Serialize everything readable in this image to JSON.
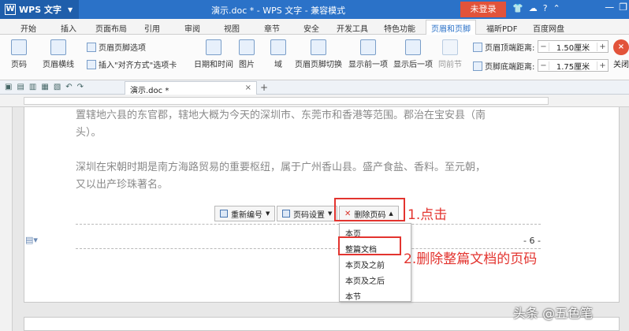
{
  "titlebar": {
    "app_name": "WPS 文字",
    "title": "演示.doc * - WPS 文字 - 兼容模式",
    "login": "未登录"
  },
  "menu_tabs": [
    "开始",
    "插入",
    "页面布局",
    "引用",
    "审阅",
    "视图",
    "章节",
    "安全",
    "开发工具",
    "特色功能",
    "页眉和页脚",
    "福昕PDF",
    "百度网盘"
  ],
  "active_tab": "页眉和页脚",
  "ribbon": {
    "page_number": "页码",
    "header_line": "页眉横线",
    "header_footer_options": "页眉页脚选项",
    "insert_align_tab": "插入\"对齐方式\"选项卡",
    "date_time": "日期和时间",
    "picture": "图片",
    "field": "域",
    "hf_switch": "页眉页脚切换",
    "show_prev": "显示前一项",
    "show_next": "显示后一项",
    "same_section": "同前节",
    "header_top_dist_label": "页眉顶端距离:",
    "header_top_dist_value": "1.50厘米",
    "footer_bottom_dist_label": "页脚底端距离:",
    "footer_bottom_dist_value": "1.75厘米",
    "close": "关闭"
  },
  "doc_tab": {
    "name": "演示.doc *"
  },
  "document": {
    "para1_line1": "置辖地六县的东官郡，辖地大概为今天的深圳市、东莞市和香港等范围。郡治在宝安县（南",
    "para1_line2": "头）。",
    "para2_line1": "深圳在宋朝时期是南方海路贸易的重要枢纽，属于广州香山县。盛产食盐、香料。至元朝，",
    "para2_line2": "又以出产珍珠著名。"
  },
  "page_number_toolbar": {
    "renumber": "重新编号",
    "settings": "页码设置",
    "delete": "删除页码"
  },
  "delete_menu": {
    "items": [
      "本页",
      "整篇文档",
      "本页及之前",
      "本页及之后",
      "本节"
    ]
  },
  "page_number_text": "- 6 -",
  "annotations": {
    "step1": "1.点击",
    "step2": "2.删除整篇文档的页码"
  },
  "watermark": "头条 @五色笔",
  "colors": {
    "title_blue": "#2b72c8",
    "annotation_red": "#e3342f",
    "login_red": "#e2533a"
  }
}
